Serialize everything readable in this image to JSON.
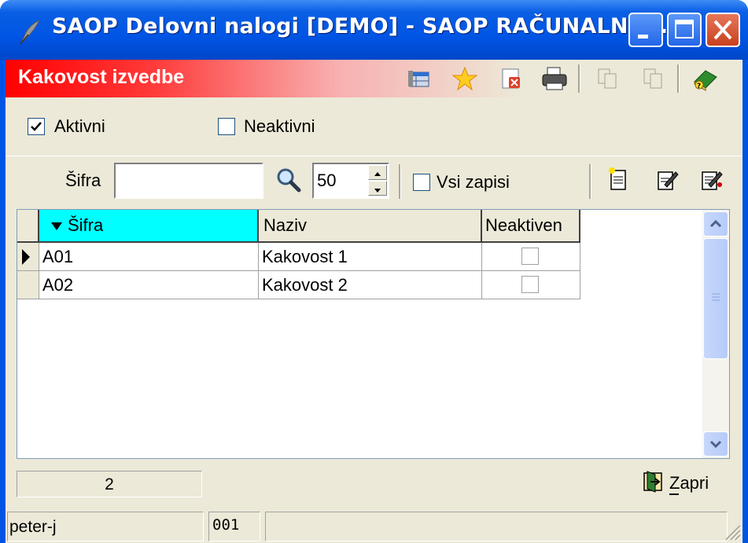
{
  "window": {
    "title": "SAOP Delovni nalogi  [DEMO] - SAOP RAČUNALNIŠ..."
  },
  "header": {
    "title": "Kakovost izvedbe"
  },
  "filters": {
    "active_label": "Aktivni",
    "active_checked": true,
    "inactive_label": "Neaktivni",
    "inactive_checked": false
  },
  "search": {
    "label": "Šifra",
    "value": "",
    "limit_value": "50",
    "all_records_label": "Vsi zapisi"
  },
  "table": {
    "columns": [
      "Šifra",
      "Naziv",
      "Neaktiven"
    ],
    "sort_column": "Šifra",
    "rows": [
      {
        "code": "A01",
        "name": "Kakovost 1",
        "inactive": false
      },
      {
        "code": "A02",
        "name": "Kakovost 2",
        "inactive": false
      }
    ]
  },
  "footer": {
    "count": "2",
    "close_label": "Zapri"
  },
  "statusbar": {
    "user": "peter-j",
    "code": "001",
    "info": ""
  },
  "colors": {
    "titlebar": "#0055e5",
    "header_red": "#ff0000",
    "sort_header": "#00ffff",
    "face": "#ece9d8"
  }
}
